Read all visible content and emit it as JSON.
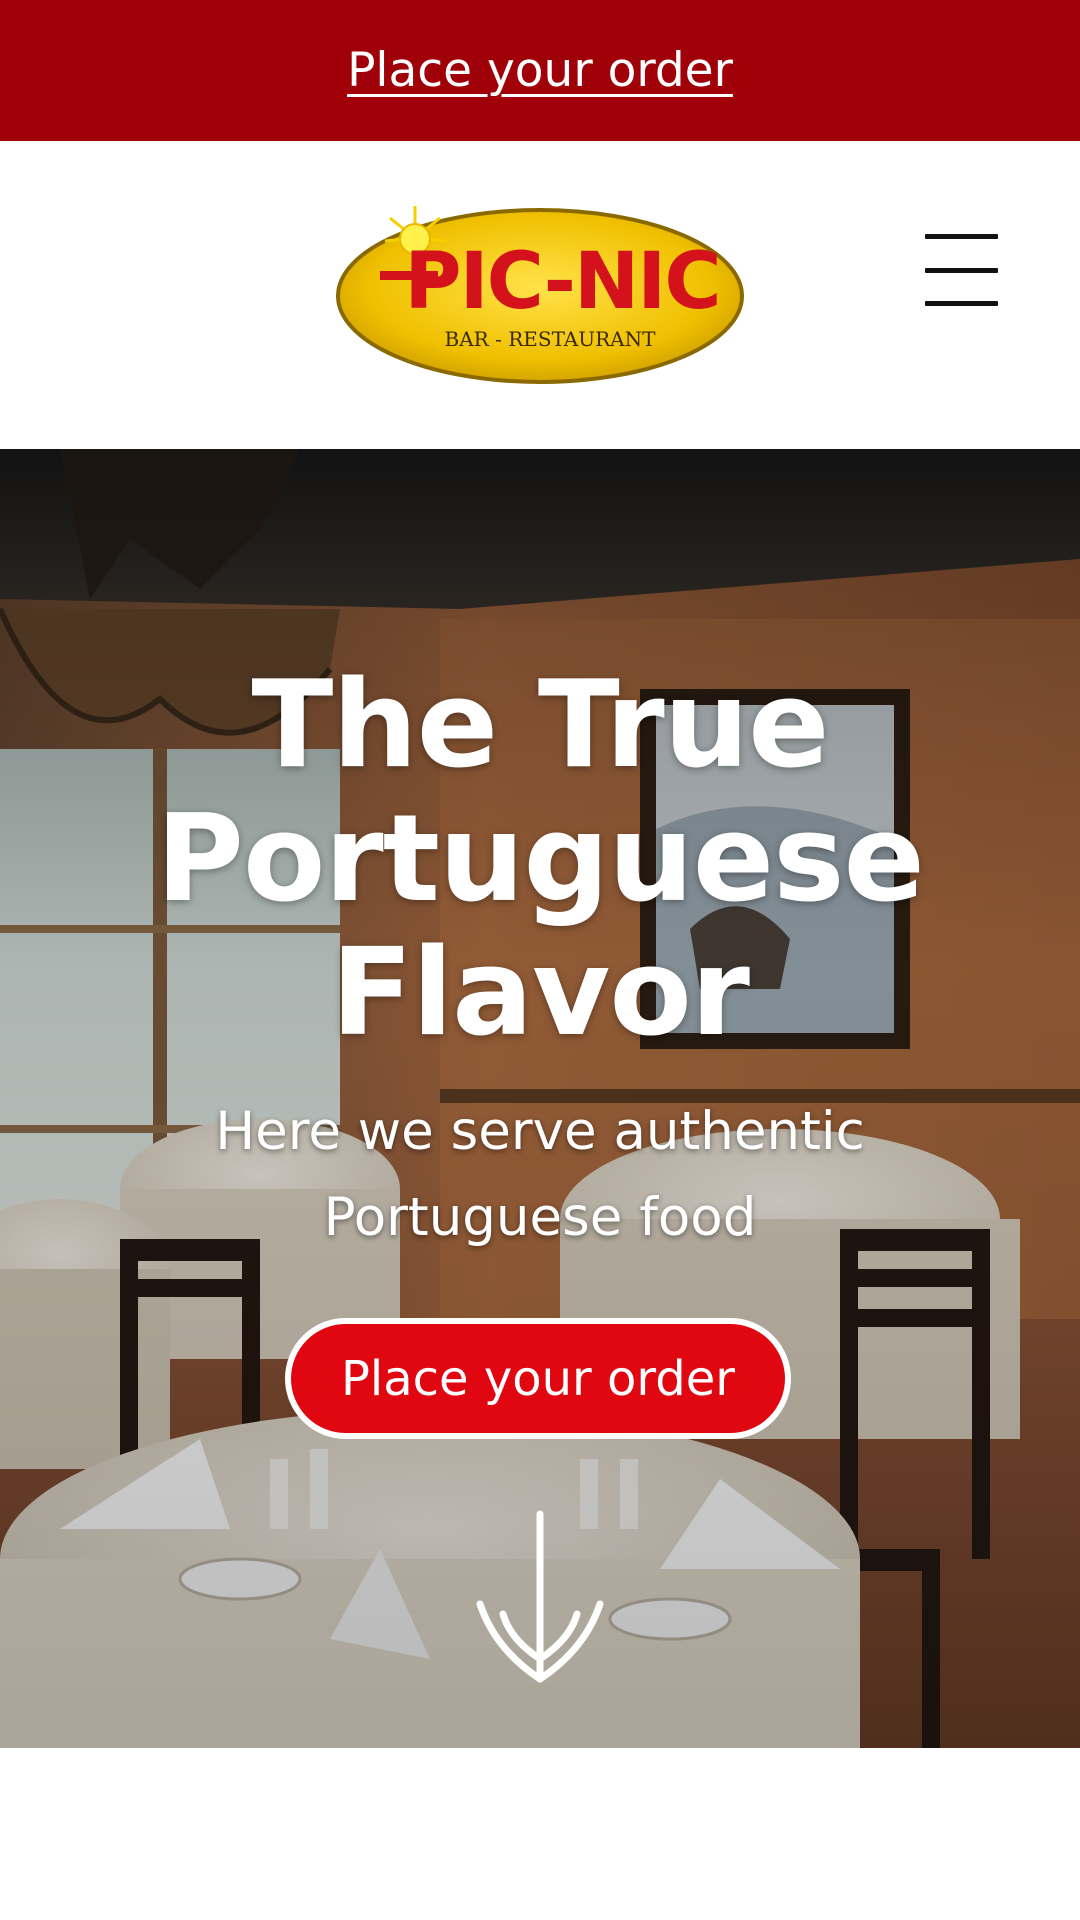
{
  "top_bar": {
    "order_link": "Place your order",
    "color": "#a00008"
  },
  "header": {
    "logo": {
      "brand": "PIC-NIC",
      "tagline": "BAR - RESTAURANT",
      "colors": {
        "fill": "#f2c400",
        "text": "#d4121b",
        "outline": "#8a6a00"
      }
    },
    "menu_icon": "hamburger-menu-icon"
  },
  "hero": {
    "title_lines": [
      "The True",
      "Portuguese",
      "Flavor"
    ],
    "subtitle": "Here we serve authentic Portuguese food",
    "cta_label": "Place your order",
    "cta_color": "#e10710",
    "scroll_icon": "scroll-down-arrow-icon"
  }
}
